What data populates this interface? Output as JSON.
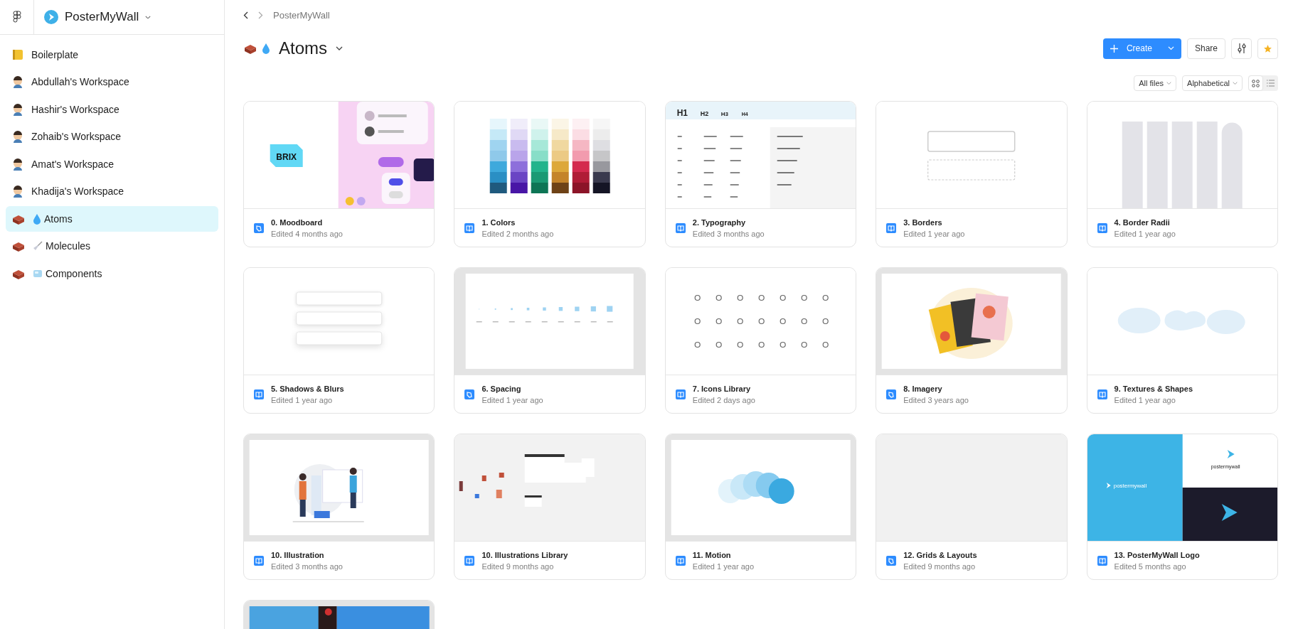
{
  "sidebar": {
    "team": {
      "name": "PosterMyWall"
    },
    "items": [
      {
        "label": "Boilerplate",
        "selected": false
      },
      {
        "label": "Abdullah's Workspace",
        "selected": false
      },
      {
        "label": "Hashir's Workspace",
        "selected": false
      },
      {
        "label": "Zohaib's Workspace",
        "selected": false
      },
      {
        "label": "Amat's Workspace",
        "selected": false
      },
      {
        "label": "Khadija's Workspace",
        "selected": false
      },
      {
        "label": "Atoms",
        "selected": true
      },
      {
        "label": "Molecules",
        "selected": false
      },
      {
        "label": "Components",
        "selected": false
      }
    ]
  },
  "breadcrumb": "PosterMyWall",
  "project": {
    "title": "Atoms"
  },
  "actions": {
    "create": "Create",
    "share": "Share"
  },
  "toolbar": {
    "filter": "All files",
    "sort": "Alphabetical",
    "views": [
      {
        "selected": true
      },
      {
        "selected": false
      }
    ]
  },
  "files": [
    {
      "name": "0. Moodboard",
      "edited": "Edited 4 months ago",
      "kind": "design",
      "preview_texts": [
        "BRIX"
      ]
    },
    {
      "name": "1. Colors",
      "edited": "Edited 2 months ago",
      "kind": "library"
    },
    {
      "name": "2. Typography",
      "edited": "Edited 3 months ago",
      "kind": "library",
      "preview_texts": [
        "H1",
        "H2",
        "H3",
        "H4"
      ]
    },
    {
      "name": "3. Borders",
      "edited": "Edited 1 year ago",
      "kind": "library"
    },
    {
      "name": "4. Border Radii",
      "edited": "Edited 1 year ago",
      "kind": "library"
    },
    {
      "name": "5. Shadows & Blurs",
      "edited": "Edited 1 year ago",
      "kind": "library"
    },
    {
      "name": "6. Spacing",
      "edited": "Edited 1 year ago",
      "kind": "design"
    },
    {
      "name": "7. Icons Library",
      "edited": "Edited 2 days ago",
      "kind": "library"
    },
    {
      "name": "8. Imagery",
      "edited": "Edited 3 years ago",
      "kind": "design"
    },
    {
      "name": "9. Textures & Shapes",
      "edited": "Edited 1 year ago",
      "kind": "library"
    },
    {
      "name": "10. Illustration",
      "edited": "Edited 3 months ago",
      "kind": "library"
    },
    {
      "name": "10. Illustrations Library",
      "edited": "Edited 9 months ago",
      "kind": "library"
    },
    {
      "name": "11. Motion",
      "edited": "Edited 1 year ago",
      "kind": "library"
    },
    {
      "name": "12. Grids & Layouts",
      "edited": "Edited 9 months ago",
      "kind": "design"
    },
    {
      "name": "13. PosterMyWall Logo",
      "edited": "Edited 5 months ago",
      "kind": "library",
      "preview_texts": [
        "postermywall",
        "postermywall"
      ]
    },
    {
      "kind": "cut_off"
    }
  ]
}
